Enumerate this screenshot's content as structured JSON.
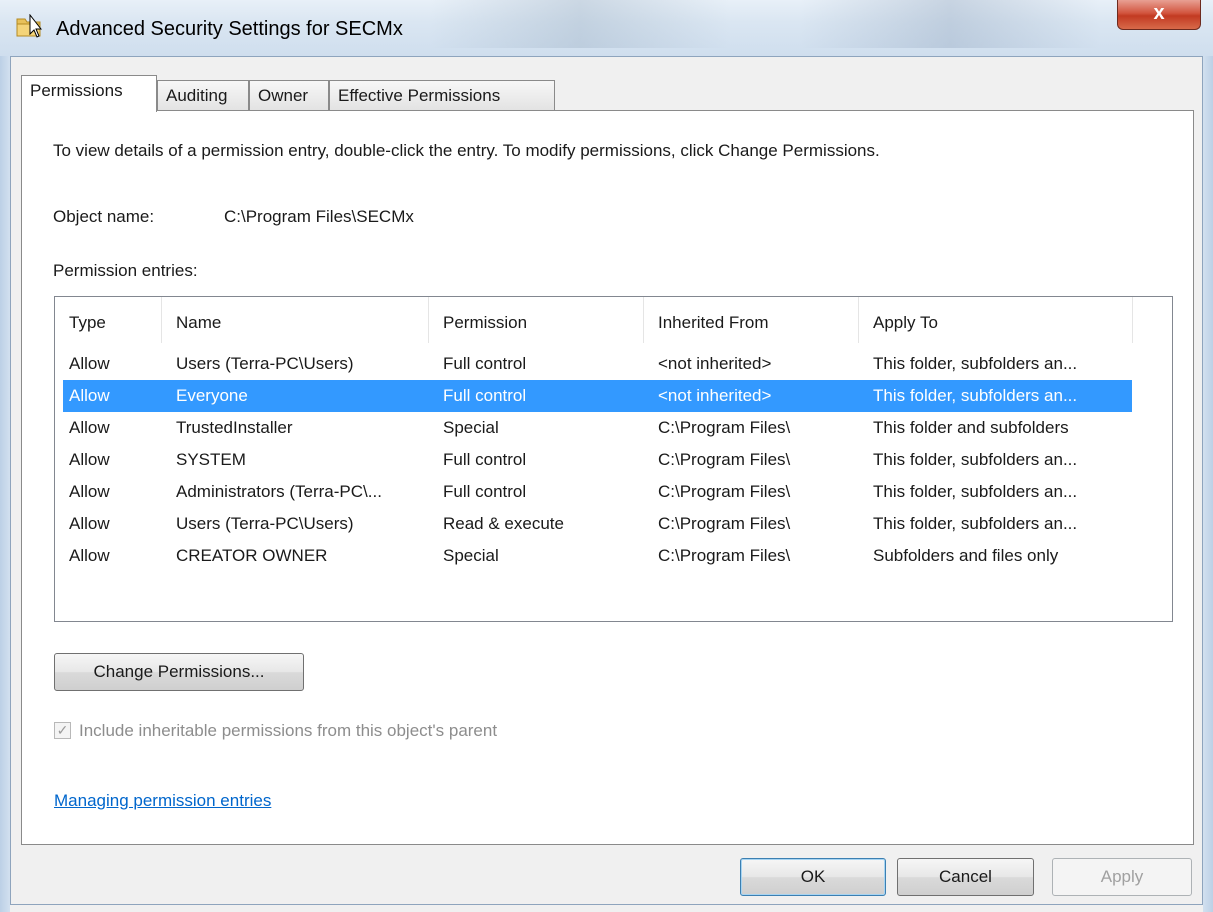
{
  "window": {
    "title": "Advanced Security Settings for SECMx",
    "close_label": "x"
  },
  "tabs": [
    {
      "label": "Permissions",
      "active": true
    },
    {
      "label": "Auditing",
      "active": false
    },
    {
      "label": "Owner",
      "active": false
    },
    {
      "label": "Effective Permissions",
      "active": false
    }
  ],
  "permissions": {
    "intro": "To view details of a permission entry, double-click the entry. To modify permissions, click Change Permissions.",
    "object_name_label": "Object name:",
    "object_name_value": "C:\\Program Files\\SECMx",
    "entries_label": "Permission entries:",
    "columns": [
      "Type",
      "Name",
      "Permission",
      "Inherited From",
      "Apply To"
    ],
    "rows": [
      {
        "type": "Allow",
        "name": "Users (Terra-PC\\Users)",
        "permission": "Full control",
        "inherited_from": "<not inherited>",
        "apply_to": "This folder, subfolders an...",
        "selected": false
      },
      {
        "type": "Allow",
        "name": "Everyone",
        "permission": "Full control",
        "inherited_from": "<not inherited>",
        "apply_to": "This folder, subfolders an...",
        "selected": true
      },
      {
        "type": "Allow",
        "name": "TrustedInstaller",
        "permission": "Special",
        "inherited_from": "C:\\Program Files\\",
        "apply_to": "This folder and subfolders",
        "selected": false
      },
      {
        "type": "Allow",
        "name": "SYSTEM",
        "permission": "Full control",
        "inherited_from": "C:\\Program Files\\",
        "apply_to": "This folder, subfolders an...",
        "selected": false
      },
      {
        "type": "Allow",
        "name": "Administrators (Terra-PC\\...",
        "permission": "Full control",
        "inherited_from": "C:\\Program Files\\",
        "apply_to": "This folder, subfolders an...",
        "selected": false
      },
      {
        "type": "Allow",
        "name": "Users (Terra-PC\\Users)",
        "permission": "Read & execute",
        "inherited_from": "C:\\Program Files\\",
        "apply_to": "This folder, subfolders an...",
        "selected": false
      },
      {
        "type": "Allow",
        "name": "CREATOR OWNER",
        "permission": "Special",
        "inherited_from": "C:\\Program Files\\",
        "apply_to": "Subfolders and files only",
        "selected": false
      }
    ],
    "change_button": "Change Permissions...",
    "inherit_checkbox": {
      "label": "Include inheritable permissions from this object's parent",
      "checked": true,
      "disabled": true
    },
    "help_link": "Managing permission entries"
  },
  "footer": {
    "ok": "OK",
    "cancel": "Cancel",
    "apply": "Apply"
  },
  "colors": {
    "selection": "#3399ff",
    "link": "#0066cc",
    "close_button": "#c23a22"
  }
}
